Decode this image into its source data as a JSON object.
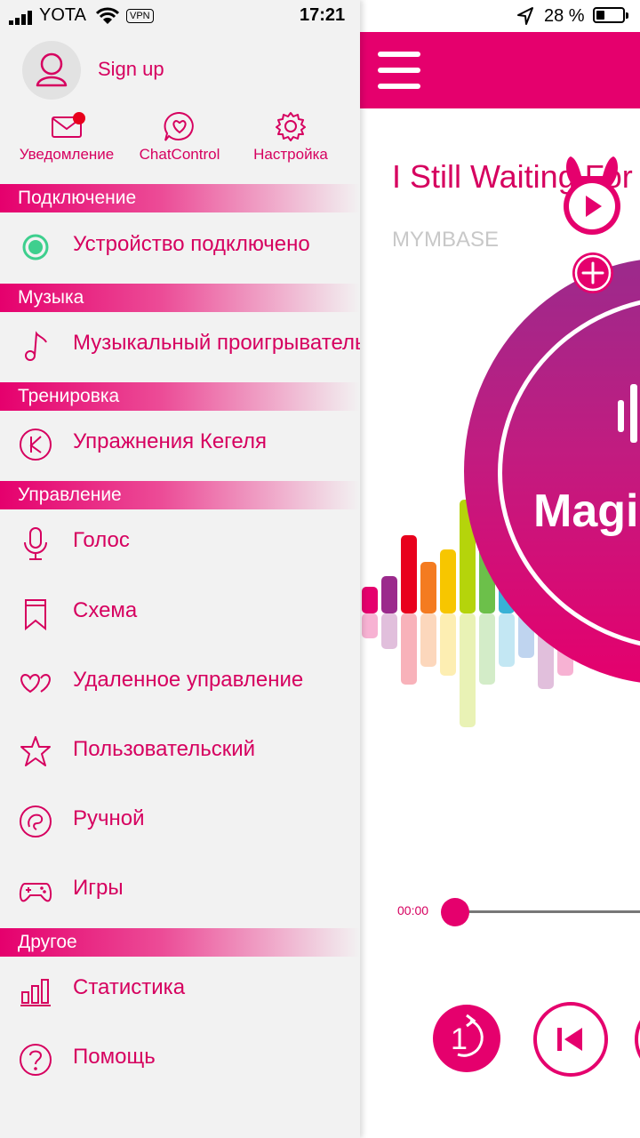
{
  "status": {
    "carrier": "YOTA",
    "vpn": "VPN",
    "time": "17:21",
    "battery": "28 %"
  },
  "drawer": {
    "signup": "Sign up",
    "quick": [
      {
        "label": "Уведомление",
        "icon": "mail-icon"
      },
      {
        "label": "ChatControl",
        "icon": "heart-chat-icon"
      },
      {
        "label": "Настройка",
        "icon": "gear-icon"
      }
    ],
    "sections": {
      "connection": "Подключение",
      "music": "Музыка",
      "training": "Тренировка",
      "control": "Управление",
      "other": "Другое"
    },
    "items": {
      "device": "Устройство подключено",
      "music_player": "Музыкальный проигрыватель",
      "kegel": "Упражнения Кегеля",
      "voice": "Голос",
      "scheme": "Схема",
      "remote": "Удаленное управление",
      "custom": "Пользовательский",
      "manual": "Ручной",
      "games": "Игры",
      "stats": "Статистика",
      "help": "Помощь"
    },
    "connected_color": "#3ecf8e"
  },
  "player": {
    "title": "I Still Waiting For",
    "artist": "MYMBASE",
    "disc_text": "Magic",
    "elapsed": "00:00",
    "progress": 0,
    "accent": "#e5006d"
  }
}
